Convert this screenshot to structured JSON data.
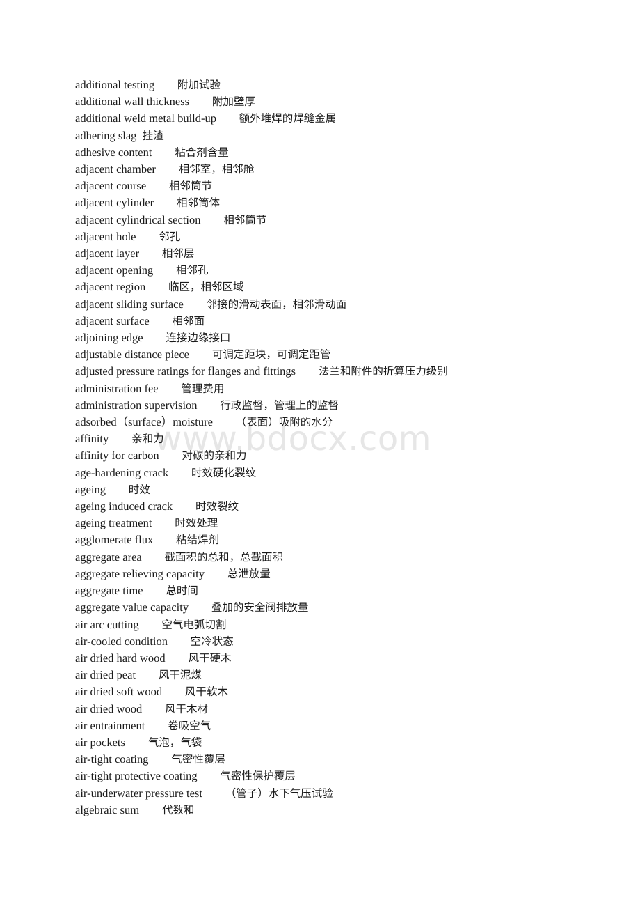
{
  "document": {
    "type": "bilingual-glossary",
    "language_pair": "English-Chinese",
    "background_color": "#ffffff",
    "text_color": "#1a1a1a"
  },
  "watermark": {
    "text": "www.bdocx.com",
    "color": "#e6e6e6"
  },
  "entries": [
    {
      "term": "additional testing",
      "gloss": "附加试验",
      "gap": 4
    },
    {
      "term": "additional wall thickness",
      "gloss": "附加壁厚",
      "gap": 4
    },
    {
      "term": "additional weld metal build-up",
      "gloss": "额外堆焊的焊缝金属",
      "gap": 4
    },
    {
      "term": "adhering slag",
      "gloss": "挂渣",
      "gap": 1
    },
    {
      "term": "adhesive content",
      "gloss": "粘合剂含量",
      "gap": 4
    },
    {
      "term": "adjacent chamber",
      "gloss": "相邻室，相邻舱",
      "gap": 4
    },
    {
      "term": "adjacent course",
      "gloss": "相邻筒节",
      "gap": 4
    },
    {
      "term": "adjacent cylinder",
      "gloss": "相邻筒体",
      "gap": 4
    },
    {
      "term": "adjacent cylindrical section",
      "gloss": "相邻筒节",
      "gap": 4
    },
    {
      "term": "adjacent hole",
      "gloss": "邻孔",
      "gap": 4
    },
    {
      "term": "adjacent layer",
      "gloss": "相邻层",
      "gap": 4
    },
    {
      "term": "adjacent opening",
      "gloss": "相邻孔",
      "gap": 4
    },
    {
      "term": "adjacent region",
      "gloss": "临区，相邻区域",
      "gap": 4
    },
    {
      "term": "adjacent sliding surface",
      "gloss": "邻接的滑动表面，相邻滑动面",
      "gap": 4
    },
    {
      "term": "adjacent surface",
      "gloss": "相邻面",
      "gap": 4
    },
    {
      "term": "adjoining edge",
      "gloss": "连接边缘接口",
      "gap": 4
    },
    {
      "term": "adjustable distance piece",
      "gloss": "可调定距块，可调定距管",
      "gap": 4
    },
    {
      "term": "adjusted pressure ratings for flanges and fittings",
      "gloss": "法兰和附件的折算压力级别",
      "gap": 4
    },
    {
      "term": "administration fee",
      "gloss": "管理费用",
      "gap": 4
    },
    {
      "term": "administration supervision",
      "gloss": "行政监督，管理上的监督",
      "gap": 4
    },
    {
      "term": "adsorbed（surface）moisture",
      "gloss": "（表面）吸附的水分",
      "gap": 4
    },
    {
      "term": "affinity",
      "gloss": "亲和力",
      "gap": 4
    },
    {
      "term": "affinity for carbon",
      "gloss": "对碳的亲和力",
      "gap": 4
    },
    {
      "term": "age-hardening crack",
      "gloss": "时效硬化裂纹",
      "gap": 4
    },
    {
      "term": "ageing",
      "gloss": "时效",
      "gap": 4
    },
    {
      "term": "ageing induced crack",
      "gloss": "时效裂纹",
      "gap": 4
    },
    {
      "term": "ageing treatment",
      "gloss": "时效处理",
      "gap": 4
    },
    {
      "term": "agglomerate flux",
      "gloss": "粘结焊剂",
      "gap": 4
    },
    {
      "term": "aggregate area",
      "gloss": "截面积的总和，总截面积",
      "gap": 4
    },
    {
      "term": "aggregate relieving capacity",
      "gloss": "总泄放量",
      "gap": 4
    },
    {
      "term": "aggregate time",
      "gloss": "总时间",
      "gap": 4
    },
    {
      "term": "aggregate value capacity",
      "gloss": "叠加的安全阀排放量",
      "gap": 4
    },
    {
      "term": "air arc cutting",
      "gloss": "空气电弧切割",
      "gap": 4
    },
    {
      "term": "air-cooled condition",
      "gloss": "空冷状态",
      "gap": 4
    },
    {
      "term": "air dried hard wood",
      "gloss": "风干硬木",
      "gap": 4
    },
    {
      "term": "air dried peat",
      "gloss": "风干泥煤",
      "gap": 4
    },
    {
      "term": "air dried soft wood",
      "gloss": "风干软木",
      "gap": 4
    },
    {
      "term": "air dried wood",
      "gloss": "风干木材",
      "gap": 4
    },
    {
      "term": "air entrainment",
      "gloss": "卷吸空气",
      "gap": 4
    },
    {
      "term": "air pockets",
      "gloss": "气泡，气袋",
      "gap": 4
    },
    {
      "term": "air-tight coating",
      "gloss": "气密性覆层",
      "gap": 4
    },
    {
      "term": "air-tight protective coating",
      "gloss": "气密性保护覆层",
      "gap": 4
    },
    {
      "term": "air-underwater pressure test",
      "gloss": "（管子）水下气压试验",
      "gap": 4
    },
    {
      "term": "algebraic sum",
      "gloss": "代数和",
      "gap": 4
    }
  ]
}
